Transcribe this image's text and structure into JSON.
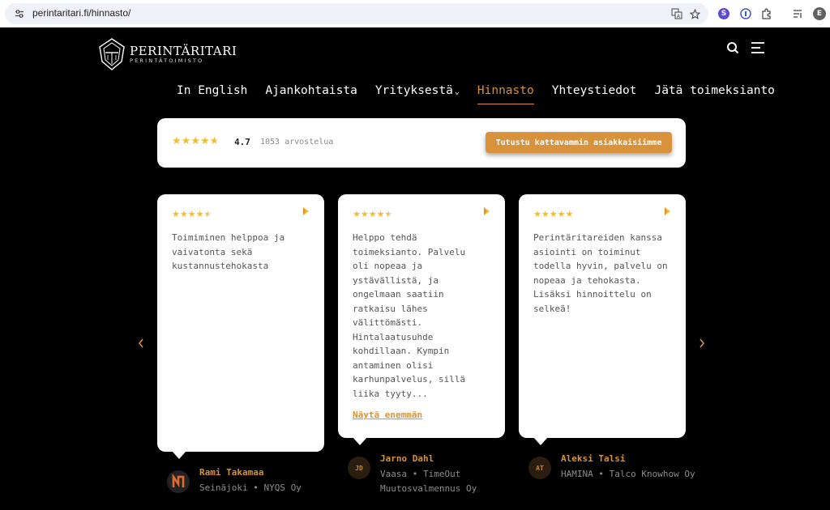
{
  "browser": {
    "url": "perintaritari.fi/hinnasto/",
    "profile_initial": "E",
    "extension_s": "S"
  },
  "brand": {
    "title": "PERINTÄRITARI",
    "subtitle": "PERINTÄTOIMISTO"
  },
  "nav": {
    "items": [
      "In English",
      "Ajankohtaista",
      "Yrityksestä",
      "Hinnasto",
      "Yhteystiedot",
      "Jätä toimeksianto"
    ],
    "active_index": 3
  },
  "summary": {
    "score": "4.7",
    "count": "1053 arvostelua",
    "button": "Tutustu kattavammin asiakkaisiimme",
    "stars": 4.7
  },
  "reviews": [
    {
      "stars": 4.5,
      "text": "Toimiminen helppoa ja vaivatonta sekä kustannustehokasta",
      "more": "",
      "name": "Rami Takamaa",
      "initials": "",
      "meta": "Seinäjoki • NYQS Oy"
    },
    {
      "stars": 4.5,
      "text": "Helppo tehdä toimeksianto. Palvelu oli nopeaa ja ystävällistä, ja ongelmaan saatiin ratkaisu lähes välittömästi. Hintalaatusuhde kohdillaan. Kympin antaminen olisi karhunpalvelus, sillä liika tyyty...",
      "more": "Näytä enemmän",
      "name": "Jarno Dahl",
      "initials": "JD",
      "meta": "Vaasa • TimeOut Muutosvalmennus Oy"
    },
    {
      "stars": 5,
      "text": "Perintäritareiden kanssa asiointi on toiminut todella hyvin, palvelu on nopeaa ja tehokasta. Lisäksi hinnoittelu on selkeä!",
      "more": "",
      "name": "Aleksi Talsi",
      "initials": "AT",
      "meta": "HAMINA • Talco Knowhow Oy"
    }
  ],
  "colors": {
    "accent": "#d7923b",
    "star": "#f3bc2a",
    "background": "#000000",
    "card": "#ffffff"
  },
  "icons": [
    "tune-icon",
    "translate-icon",
    "star-icon",
    "extension-icon",
    "reading-list-icon",
    "search-icon",
    "menu-icon",
    "chevron-left-icon",
    "chevron-right-icon",
    "play-arrow-icon",
    "knight-helmet-logo"
  ]
}
